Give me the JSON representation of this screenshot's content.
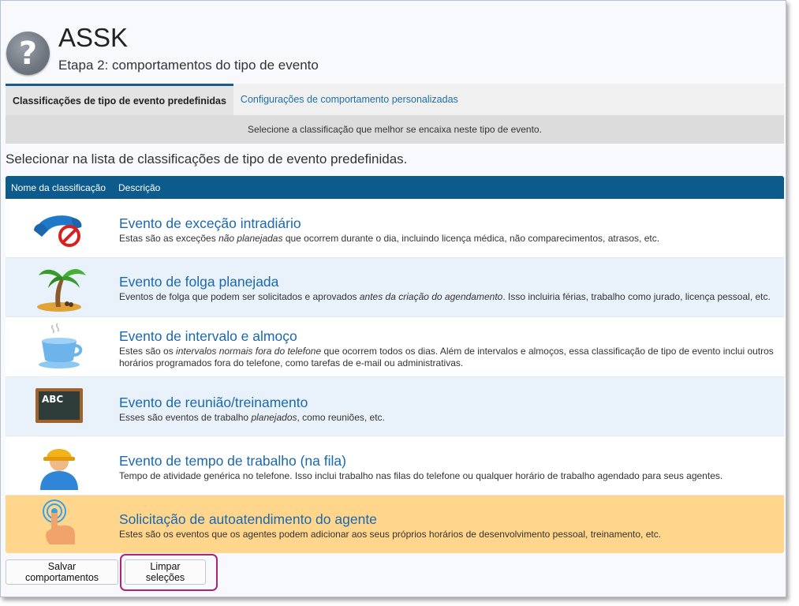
{
  "header": {
    "title": "ASSK",
    "subtitle": "Etapa 2: comportamentos do tipo de evento"
  },
  "tabs": [
    {
      "label": "Classificações de tipo de evento predefinidas",
      "active": true
    },
    {
      "label": "Configurações de comportamento personalizadas",
      "active": false
    }
  ],
  "info_bar": "Selecione a classificação que melhor se encaixa neste tipo de evento.",
  "section_heading": "Selecionar na lista de classificações de tipo de evento predefinidas.",
  "table": {
    "col_name": "Nome da classificação",
    "col_desc": "Descrição"
  },
  "rows": [
    {
      "icon": "phone-blocked-icon",
      "name": "Evento de exceção intradiário",
      "desc_pre": "Estas são as exceções ",
      "desc_em": "não planejadas",
      "desc_post": " que ocorrem durante o dia, incluindo licença médica, não comparecimentos, atrasos, etc."
    },
    {
      "icon": "palm-tree-icon",
      "name": "Evento de folga planejada",
      "desc_pre": "Eventos de folga que podem ser solicitados e aprovados ",
      "desc_em": "antes da criação do agendamento",
      "desc_post": ". Isso incluiria férias, trabalho como jurado, licença pessoal, etc."
    },
    {
      "icon": "coffee-cup-icon",
      "name": "Evento de intervalo e almoço",
      "desc_pre": "Estes são os ",
      "desc_em": "intervalos normais fora do telefone",
      "desc_post": " que ocorrem todos os dias. Além de intervalos e almoços, essa classificação de tipo de evento inclui outros horários programados fora do telefone, como tarefas de e-mail ou administrativas."
    },
    {
      "icon": "chalkboard-icon",
      "icon_text": "ABC",
      "name": "Evento de reunião/treinamento",
      "desc_pre": "Esses são eventos de trabalho ",
      "desc_em": "planejados",
      "desc_post": ", como reuniões, etc."
    },
    {
      "icon": "worker-hardhat-icon",
      "name": "Evento de tempo de trabalho (na fila)",
      "desc_pre": "Tempo de atividade genérica no telefone. Isso inclui trabalho nas filas do telefone ou qualquer horário de trabalho agendado para seus agentes.",
      "desc_em": "",
      "desc_post": ""
    },
    {
      "icon": "touch-hand-icon",
      "name": "Solicitação de autoatendimento do agente",
      "desc_pre": "Estes são os eventos que os agentes podem adicionar aos seus próprios horários de desenvolvimento pessoal, treinamento, etc.",
      "desc_em": "",
      "desc_post": "",
      "selected": true
    }
  ],
  "buttons": {
    "save": "Salvar comportamentos",
    "clear": "Limpar seleções"
  },
  "colors": {
    "header_blue": "#0d5a8c",
    "link_blue": "#1a68b0",
    "selected_row": "#ffd68c",
    "highlight_magenta": "#a8247e"
  }
}
